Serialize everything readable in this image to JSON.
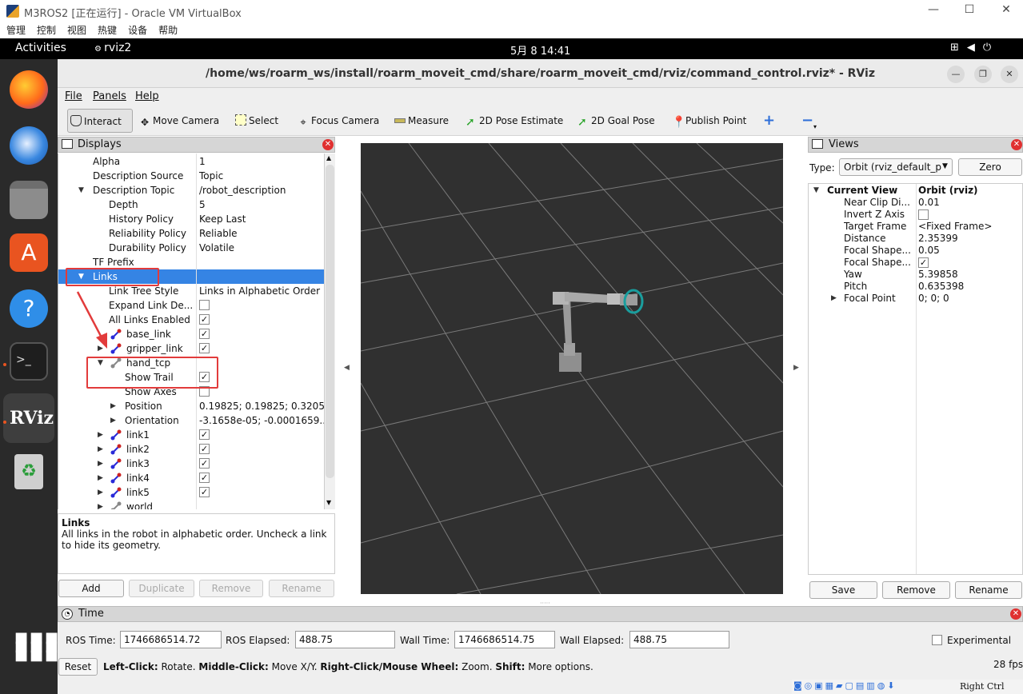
{
  "vbox": {
    "title": "M3ROS2 [正在运行] - Oracle VM VirtualBox",
    "menu": [
      "管理",
      "控制",
      "视图",
      "热键",
      "设备",
      "帮助"
    ],
    "hotkey": "Right Ctrl"
  },
  "gnome": {
    "activities": "Activities",
    "app_name": "rviz2",
    "clock": "5月 8  14:41"
  },
  "dock": [
    "firefox-icon",
    "thunderbird-icon",
    "files-icon",
    "app-center-icon",
    "help-icon",
    "terminal-icon",
    "rviz-icon",
    "trash-icon"
  ],
  "rviz": {
    "window_title": "/home/ws/roarm_ws/install/roarm_moveit_cmd/share/roarm_moveit_cmd/rviz/command_control.rviz* - RViz",
    "menu": [
      "File",
      "Panels",
      "Help"
    ],
    "tools": [
      "Interact",
      "Move Camera",
      "Select",
      "Focus Camera",
      "Measure",
      "2D Pose Estimate",
      "2D Goal Pose",
      "Publish Point"
    ]
  },
  "displays": {
    "title": "Displays",
    "rows": [
      {
        "k": "Alpha",
        "v": "1"
      },
      {
        "k": "Description Source",
        "v": "Topic"
      },
      {
        "k": "Description Topic",
        "v": "/robot_description"
      },
      {
        "k": "Depth",
        "v": "5"
      },
      {
        "k": "History Policy",
        "v": "Keep Last"
      },
      {
        "k": "Reliability Policy",
        "v": "Reliable"
      },
      {
        "k": "Durability Policy",
        "v": "Volatile"
      },
      {
        "k": "TF Prefix",
        "v": ""
      },
      {
        "k": "Links",
        "v": ""
      },
      {
        "k": "Link Tree Style",
        "v": "Links in Alphabetic Order"
      },
      {
        "k": "Expand Link De...",
        "v": ""
      },
      {
        "k": "All Links Enabled",
        "v": ""
      },
      {
        "k": "base_link",
        "v": ""
      },
      {
        "k": "gripper_link",
        "v": ""
      },
      {
        "k": "hand_tcp",
        "v": ""
      },
      {
        "k": "Show Trail",
        "v": ""
      },
      {
        "k": "Show Axes",
        "v": ""
      },
      {
        "k": "Position",
        "v": "0.19825; 0.19825; 0.3205"
      },
      {
        "k": "Orientation",
        "v": "-3.1658e-05; -0.0001659..."
      },
      {
        "k": "link1",
        "v": ""
      },
      {
        "k": "link2",
        "v": ""
      },
      {
        "k": "link3",
        "v": ""
      },
      {
        "k": "link4",
        "v": ""
      },
      {
        "k": "link5",
        "v": ""
      },
      {
        "k": "world",
        "v": ""
      }
    ],
    "checks": {
      "expand_link": false,
      "all_links": true,
      "base_link": true,
      "gripper_link": true,
      "show_trail": true,
      "show_axes": false,
      "link1": true,
      "link2": true,
      "link3": true,
      "link4": true,
      "link5": true
    },
    "desc_title": "Links",
    "desc_text": "All links in the robot in alphabetic order. Uncheck a link to hide its geometry.",
    "buttons": [
      "Add",
      "Duplicate",
      "Remove",
      "Rename"
    ]
  },
  "views": {
    "title": "Views",
    "type_label": "Type:",
    "type_value": "Orbit (rviz_default_p",
    "zero": "Zero",
    "current_view": "Current View",
    "current_view_value": "Orbit (rviz)",
    "rows": [
      {
        "k": "Near Clip Di...",
        "v": "0.01"
      },
      {
        "k": "Invert Z Axis",
        "v": ""
      },
      {
        "k": "Target Frame",
        "v": "<Fixed Frame>"
      },
      {
        "k": "Distance",
        "v": "2.35399"
      },
      {
        "k": "Focal Shape...",
        "v": "0.05"
      },
      {
        "k": "Focal Shape...",
        "v": ""
      },
      {
        "k": "Yaw",
        "v": "5.39858"
      },
      {
        "k": "Pitch",
        "v": "0.635398"
      },
      {
        "k": "Focal Point",
        "v": "0; 0; 0"
      }
    ],
    "checks": {
      "invert_z": false,
      "focal_shape_fixed": true
    },
    "buttons": [
      "Save",
      "Remove",
      "Rename"
    ]
  },
  "time": {
    "title": "Time",
    "ros_time_label": "ROS Time:",
    "ros_time": "1746686514.72",
    "ros_elapsed_label": "ROS Elapsed:",
    "ros_elapsed": "488.75",
    "wall_time_label": "Wall Time:",
    "wall_time": "1746686514.75",
    "wall_elapsed_label": "Wall Elapsed:",
    "wall_elapsed": "488.75",
    "experimental": "Experimental",
    "reset": "Reset",
    "hint_b1": "Left-Click:",
    "hint_t1": " Rotate. ",
    "hint_b2": "Middle-Click:",
    "hint_t2": " Move X/Y. ",
    "hint_b3": "Right-Click/Mouse Wheel:",
    "hint_t3": " Zoom. ",
    "hint_b4": "Shift:",
    "hint_t4": " More options.",
    "fps": "28 fps"
  },
  "colors": {
    "selection": "#3584e4",
    "annotation": "#e23b3b",
    "scene_bg": "#303030"
  }
}
